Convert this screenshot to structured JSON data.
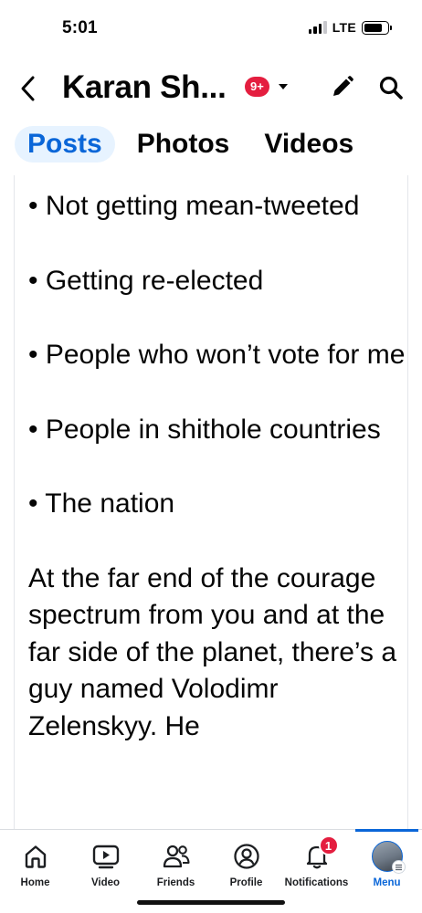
{
  "status_bar": {
    "time": "5:01",
    "network": "LTE",
    "battery_level": 0.8
  },
  "header": {
    "back_icon": "chevron-left-icon",
    "title": "Karan Sh...",
    "notification_badge": "9+",
    "dropdown_icon": "caret-down-icon",
    "edit_icon": "pencil-icon",
    "search_icon": "search-icon"
  },
  "tabs": [
    {
      "label": "Posts",
      "active": true
    },
    {
      "label": "Photos",
      "active": false
    },
    {
      "label": "Videos",
      "active": false
    }
  ],
  "post": {
    "bullets": [
      "• Not getting mean-tweeted",
      "• Getting re-elected",
      "• People who won’t vote for me",
      "• People in shithole countries",
      "• The nation"
    ],
    "paragraph": "At the far end of the courage spectrum from you and at the far side of the planet, there’s a guy named Volodimr Zelenskyy. He"
  },
  "bottom_nav": {
    "items": [
      {
        "label": "Home",
        "icon": "home-icon"
      },
      {
        "label": "Video",
        "icon": "video-icon"
      },
      {
        "label": "Friends",
        "icon": "friends-icon"
      },
      {
        "label": "Profile",
        "icon": "profile-icon"
      },
      {
        "label": "Notifications",
        "icon": "bell-icon",
        "badge": "1"
      },
      {
        "label": "Menu",
        "icon": "menu-avatar-icon",
        "active": true
      }
    ]
  },
  "colors": {
    "accent": "#0a66d8",
    "badge": "#e41e3f",
    "active_tab_bg": "#e7f3ff"
  }
}
